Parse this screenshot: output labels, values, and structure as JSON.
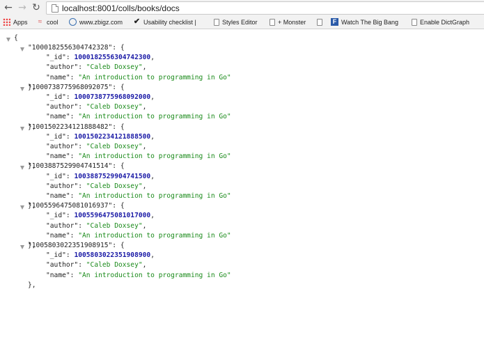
{
  "browser": {
    "url": "localhost:8001/colls/books/docs",
    "back_icon": "back-arrow-icon",
    "forward_icon": "forward-arrow-icon",
    "reload_icon": "reload-icon"
  },
  "bookmarks": [
    {
      "label": "Apps",
      "icon": "apps-grid-icon"
    },
    {
      "label": "cool",
      "icon": "cool-icon"
    },
    {
      "label": "www.zbigz.com",
      "icon": "zbigz-icon"
    },
    {
      "label": "Usability checklist |",
      "icon": "checkmark-icon"
    },
    {
      "label": "Styles Editor",
      "icon": "page-icon"
    },
    {
      "label": "+ Monster",
      "icon": "page-icon"
    },
    {
      "label": "",
      "icon": "page-icon"
    },
    {
      "label": "Watch The Big Bang",
      "icon": "f-logo-icon"
    },
    {
      "label": "Enable DictGraph",
      "icon": "page-icon"
    }
  ],
  "json": {
    "open_brace": "{",
    "records": [
      {
        "key": "\"1000182556304742328\": {",
        "id_key": "\"_id\": ",
        "id": "1000182556304742300",
        "author_key": "\"author\": ",
        "author": "\"Caleb Doxsey\"",
        "name_key": "\"name\": ",
        "name": "\"An introduction to programming in Go\"",
        "close": "},"
      },
      {
        "key": "\"1000738775968092075\": {",
        "id_key": "\"_id\": ",
        "id": "1000738775968092000",
        "author_key": "\"author\": ",
        "author": "\"Caleb Doxsey\"",
        "name_key": "\"name\": ",
        "name": "\"An introduction to programming in Go\"",
        "close": "},"
      },
      {
        "key": "\"1001502234121888482\": {",
        "id_key": "\"_id\": ",
        "id": "1001502234121888500",
        "author_key": "\"author\": ",
        "author": "\"Caleb Doxsey\"",
        "name_key": "\"name\": ",
        "name": "\"An introduction to programming in Go\"",
        "close": "},"
      },
      {
        "key": "\"1003887529904741514\": {",
        "id_key": "\"_id\": ",
        "id": "1003887529904741500",
        "author_key": "\"author\": ",
        "author": "\"Caleb Doxsey\"",
        "name_key": "\"name\": ",
        "name": "\"An introduction to programming in Go\"",
        "close": "},"
      },
      {
        "key": "\"1005596475081016937\": {",
        "id_key": "\"_id\": ",
        "id": "1005596475081017000",
        "author_key": "\"author\": ",
        "author": "\"Caleb Doxsey\"",
        "name_key": "\"name\": ",
        "name": "\"An introduction to programming in Go\"",
        "close": "},"
      },
      {
        "key": "\"1005803022351908915\": {",
        "id_key": "\"_id\": ",
        "id": "1005803022351908900",
        "author_key": "\"author\": ",
        "author": "\"Caleb Doxsey\"",
        "name_key": "\"name\": ",
        "name": "\"An introduction to programming in Go\"",
        "close": "},"
      }
    ],
    "colors": {
      "number": "#1a1aa6",
      "string": "#1a8a1a"
    }
  }
}
